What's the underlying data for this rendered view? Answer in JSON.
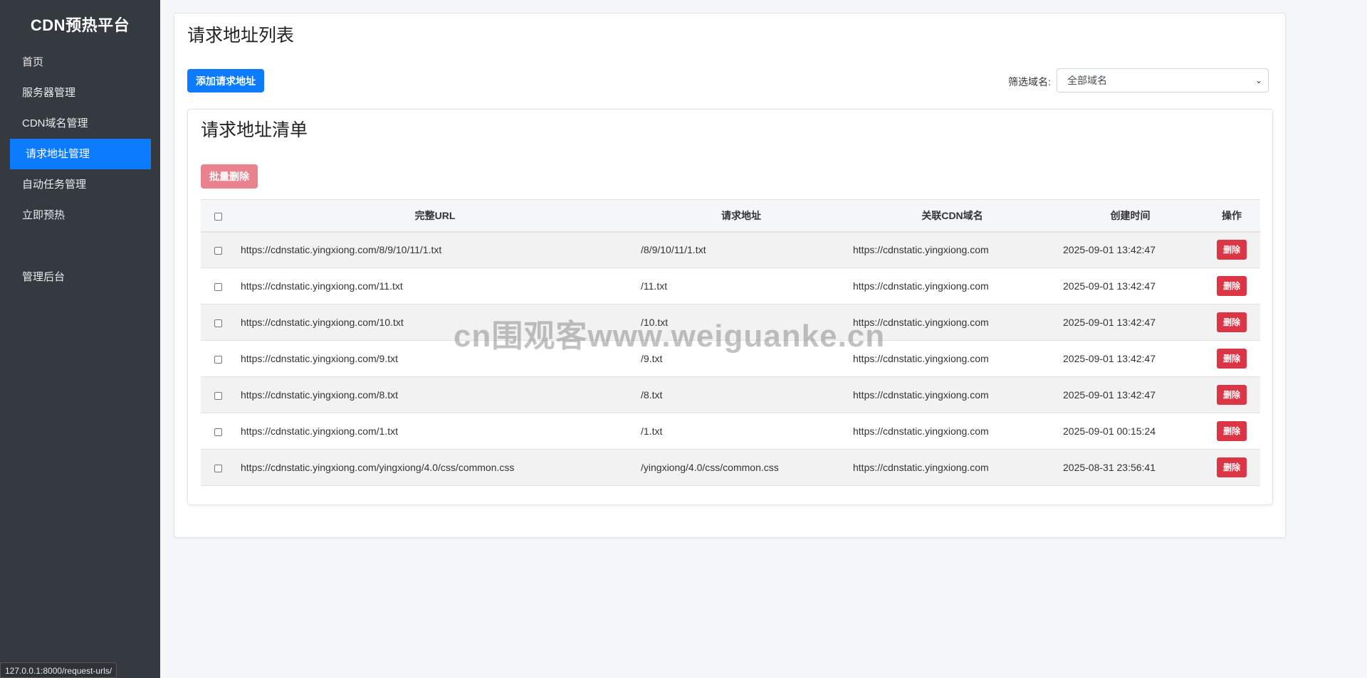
{
  "sidebar": {
    "brand": "CDN预热平台",
    "items": [
      {
        "label": "首页"
      },
      {
        "label": "服务器管理"
      },
      {
        "label": "CDN域名管理"
      },
      {
        "label": "请求地址管理"
      },
      {
        "label": "自动任务管理"
      },
      {
        "label": "立即预热"
      },
      {
        "label": "管理后台"
      }
    ],
    "active_index": 3
  },
  "status_url": "127.0.0.1:8000/request-urls/",
  "header": {
    "title": "请求地址列表",
    "add_button": "添加请求地址",
    "filter_label": "筛选域名:",
    "filter_value": "全部域名"
  },
  "list": {
    "title": "请求地址清单",
    "batch_delete": "批量删除",
    "columns": [
      "完整URL",
      "请求地址",
      "关联CDN域名",
      "创建时间",
      "操作"
    ],
    "delete_label": "删除",
    "rows": [
      {
        "full_url": "https://cdnstatic.yingxiong.com/8/9/10/11/1.txt",
        "path": "/8/9/10/11/1.txt",
        "domain": "https://cdnstatic.yingxiong.com",
        "created": "2025-09-01 13:42:47"
      },
      {
        "full_url": "https://cdnstatic.yingxiong.com/11.txt",
        "path": "/11.txt",
        "domain": "https://cdnstatic.yingxiong.com",
        "created": "2025-09-01 13:42:47"
      },
      {
        "full_url": "https://cdnstatic.yingxiong.com/10.txt",
        "path": "/10.txt",
        "domain": "https://cdnstatic.yingxiong.com",
        "created": "2025-09-01 13:42:47"
      },
      {
        "full_url": "https://cdnstatic.yingxiong.com/9.txt",
        "path": "/9.txt",
        "domain": "https://cdnstatic.yingxiong.com",
        "created": "2025-09-01 13:42:47"
      },
      {
        "full_url": "https://cdnstatic.yingxiong.com/8.txt",
        "path": "/8.txt",
        "domain": "https://cdnstatic.yingxiong.com",
        "created": "2025-09-01 13:42:47"
      },
      {
        "full_url": "https://cdnstatic.yingxiong.com/1.txt",
        "path": "/1.txt",
        "domain": "https://cdnstatic.yingxiong.com",
        "created": "2025-09-01 00:15:24"
      },
      {
        "full_url": "https://cdnstatic.yingxiong.com/yingxiong/4.0/css/common.css",
        "path": "/yingxiong/4.0/css/common.css",
        "domain": "https://cdnstatic.yingxiong.com",
        "created": "2025-08-31 23:56:41"
      }
    ]
  },
  "watermark": "cn围观客www.weiguanke.cn",
  "colors": {
    "sidebar_bg": "#343a40",
    "primary": "#0d7bfd",
    "danger": "#dc3545",
    "danger_disabled": "#e8838e"
  }
}
